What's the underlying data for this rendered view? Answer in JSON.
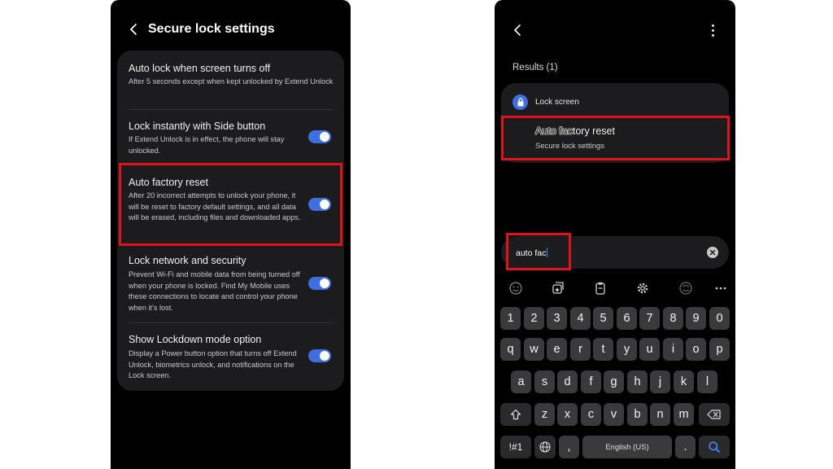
{
  "left_screen": {
    "title": "Secure lock settings",
    "items": [
      {
        "title": "Auto lock when screen turns off",
        "description": "After 5 seconds except when kept unlocked by Extend Unlock",
        "toggle": null
      },
      {
        "title": "Lock instantly with Side button",
        "description": "If Extend Unlock is in effect, the phone will stay unlocked.",
        "toggle": "on"
      },
      {
        "title": "Auto factory reset",
        "description": "After 20 incorrect attempts to unlock your phone, it will be reset to factory default settings, and all data will be erased, including files and downloaded apps.",
        "toggle": "on"
      },
      {
        "title": "Lock network and security",
        "description": "Prevent Wi-Fi and mobile data from being turned off when your phone is locked. Find My Mobile uses these connections to locate and control your phone when it's lost.",
        "toggle": "on"
      },
      {
        "title": "Show Lockdown mode option",
        "description": "Display a Power button option that turns off Extend Unlock, biometrics unlock, and notifications on the Lock screen.",
        "toggle": "on"
      }
    ]
  },
  "right_screen": {
    "results_label": "Results (1)",
    "result": {
      "category": "Lock screen",
      "title_match": "Auto fac",
      "title_rest": "tory reset",
      "subtitle": "Secure lock settings"
    },
    "search": {
      "query": "auto fac"
    },
    "keyboard": {
      "number_row": [
        "1",
        "2",
        "3",
        "4",
        "5",
        "6",
        "7",
        "8",
        "9",
        "0"
      ],
      "row1": [
        "q",
        "w",
        "e",
        "r",
        "t",
        "y",
        "u",
        "i",
        "o",
        "p"
      ],
      "row2": [
        "a",
        "s",
        "d",
        "f",
        "g",
        "h",
        "j",
        "k",
        "l"
      ],
      "row3": [
        "z",
        "x",
        "c",
        "v",
        "b",
        "n",
        "m"
      ],
      "symbols_key": "!#1",
      "comma_key": ",",
      "space_label": "English (US)",
      "period_key": "."
    }
  },
  "colors": {
    "accent": "#3e6fe0",
    "highlight": "#e0131b",
    "card": "#1c1c1e",
    "background": "#000000"
  },
  "icons": [
    "back-arrow-icon",
    "more-options-icon",
    "lock-icon",
    "clear-icon",
    "emoji-icon",
    "clipboard-ai-icon",
    "clipboard-icon",
    "gear-icon",
    "translate-icon",
    "more-horizontal-icon",
    "shift-icon",
    "backspace-icon",
    "globe-icon",
    "search-icon"
  ]
}
